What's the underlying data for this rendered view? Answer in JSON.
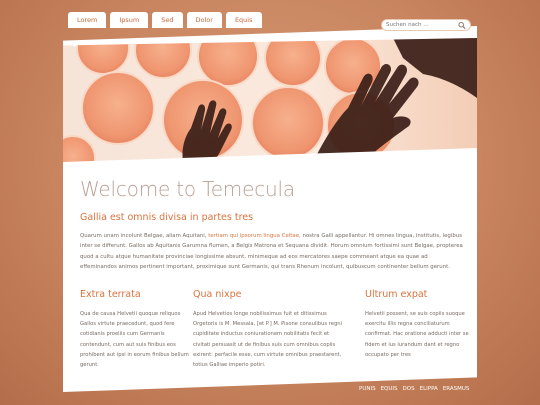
{
  "nav": {
    "tabs": [
      "Lorem",
      "Ipsum",
      "Sed",
      "Dolor",
      "Equis"
    ]
  },
  "search": {
    "placeholder": "Suchen nach ..."
  },
  "main": {
    "title": "Welcome to Temecula",
    "subtitle": "Gallia est omnis divisa in partes tres",
    "intro_before": "Quarum unam incolunt Belgae, aliam Aquitani, ",
    "intro_highlight": "tertiam qui ipsorum lingua Celtae",
    "intro_after": ", nostra Galli appellantur. Hi omnes lingua, institutis, legibus inter se differunt. Gallos ab Aquitanis Garumna flumen, a Belgis Matrona et Sequana dividit. Horum omnium fortissimi sunt Belgae, propterea quod a cultu atque humanitate provinciae longissime absunt, minimeque ad eos mercatores saepe commeant atque ea quae ad effeminandos animos pertinent important, proximique sunt Germanis, qui trans Rhenum incolunt, quibuscum continenter bellum gerunt."
  },
  "columns": [
    {
      "title": "Extra terrata",
      "text": "Qua de causa Helvetii quoque reliquos Gallos virtute praecedunt, quod fere cotidianis proeliis cum Germanis contendunt, cum aut suis finibus eos prohibent aut ipsi in eorum finibus bellum gerunt."
    },
    {
      "title": "Qua nixpe",
      "text": "Apud Helvetios longe nobilissimus fuit et ditissimus Orgetorix is M. Messala, [et P.] M. Pisone consulibus regni cupiditate inductus coniurationem nobilitatis fecit et civitati persuasit ut de finibus suis cum omnibus copiis exirent: perfacile esse, cum virtute omnibus praestarent, totius Galliae imperio potiri."
    },
    {
      "title": "Ultrum expat",
      "text": "Helvetii possent, se suis copiis suoque exercitu illis regna conciliaturum confirmat. Hac oratione adducti inter se fidem et ius iurandum dant et regno occupato per tres"
    }
  ],
  "footer": {
    "links": [
      "PUNIS",
      "EQUIS",
      "DOS",
      "ELIPPA",
      "ERASMUS"
    ]
  },
  "colors": {
    "accent": "#d7743f",
    "background": "#c8855f"
  },
  "icons": [
    "search-icon",
    "apple-icon"
  ]
}
